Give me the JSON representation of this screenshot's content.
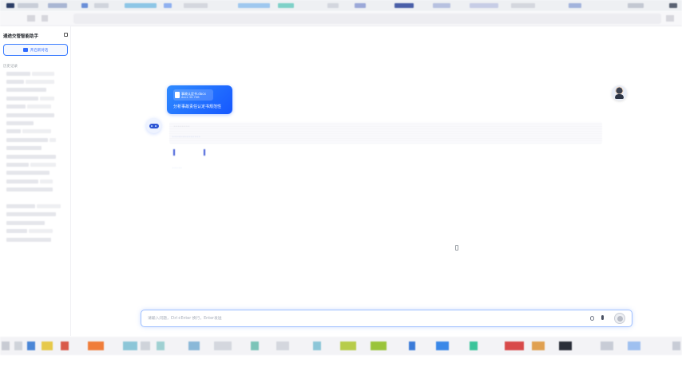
{
  "app": {
    "sidebar_title": "通途交管智能助手",
    "new_chat_label": "开启新对话",
    "history_label": "历史记录"
  },
  "conversation": {
    "user_file_name": "事故认定书.docx",
    "user_file_size": "docx 30.7KB",
    "user_message": "分析事故责任认定书规范性",
    "bot_line1": "· · · · · · · ·",
    "bot_line2": "· · · · · · · · · · · · · ·",
    "bot_line3": "· · · · ·"
  },
  "composer": {
    "placeholder": "请输入问题，Ctrl+Enter 换行，Enter发送"
  },
  "icons": {
    "new_chat": "chat-icon",
    "collapse": "sidebar-collapse-icon",
    "attach": "paperclip-icon",
    "mic": "microphone-icon",
    "send": "send-icon",
    "file": "document-icon"
  }
}
